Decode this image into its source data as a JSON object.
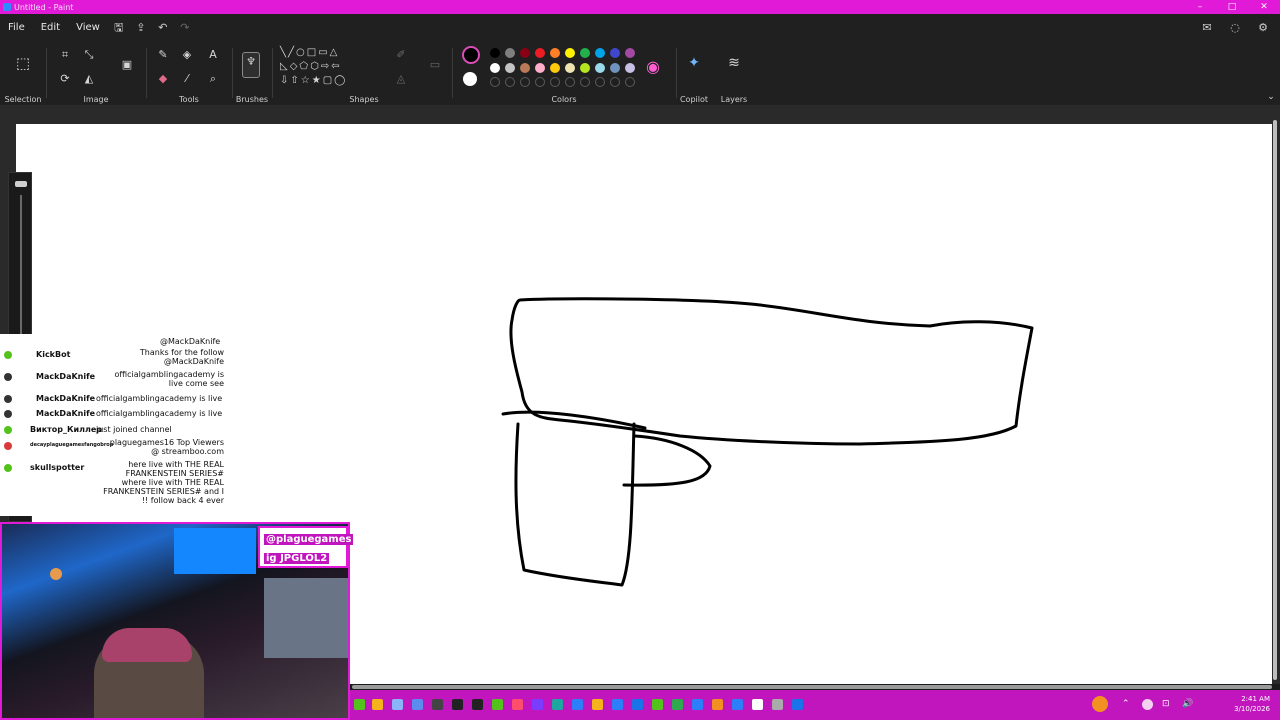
{
  "window": {
    "title": "Untitled - Paint"
  },
  "menu": {
    "file": "File",
    "edit": "Edit",
    "view": "View"
  },
  "ribbon": {
    "groups": {
      "selection": "Selection",
      "image": "Image",
      "tools": "Tools",
      "brushes": "Brushes",
      "shapes": "Shapes",
      "colors": "Colors",
      "copilot": "Copilot",
      "layers": "Layers"
    },
    "palette_row1": [
      "#000000",
      "#7f7f7f",
      "#880015",
      "#ed1c24",
      "#ff7f27",
      "#fff200",
      "#22b14c",
      "#00a2e8",
      "#3f48cc",
      "#a349a4"
    ],
    "palette_row2": [
      "#ffffff",
      "#c3c3c3",
      "#b97a57",
      "#ffaec9",
      "#ffc90e",
      "#efe4b0",
      "#b5e61d",
      "#99d9ea",
      "#7092be",
      "#c8bfe7"
    ],
    "primary_color": "#000000",
    "secondary_color": "#ffffff"
  },
  "chat": {
    "rows": [
      {
        "who": "",
        "msg": "@MackDaKnife"
      },
      {
        "who": "KickBot",
        "msg": "Thanks for the follow @MackDaKnife"
      },
      {
        "who": "MackDaKnife",
        "msg": "officialgamblingacademy is live come see"
      },
      {
        "who": "MackDaKnife",
        "msg": "officialgamblingacademy is live"
      },
      {
        "who": "MackDaKnife",
        "msg": "officialgamblingacademy is live"
      },
      {
        "who": "Виктор_Киллер",
        "msg": "just joined channel"
      },
      {
        "who": "decayplaguegamesfangobrop",
        "msg": "plaguegames16 Top Viewers @ streamboo.com"
      },
      {
        "who": "skullspotter",
        "msg": "here live with THE REAL FRANKENSTEIN SERIES# where live with THE REAL FRANKENSTEIN SERIES# and I !! follow back 4 ever"
      }
    ]
  },
  "overlay": {
    "handle": "@plaguegames",
    "code": "ig JPGLOL2"
  },
  "taskbar": {
    "time": "2:41 AM",
    "date": "3/10/2026"
  }
}
